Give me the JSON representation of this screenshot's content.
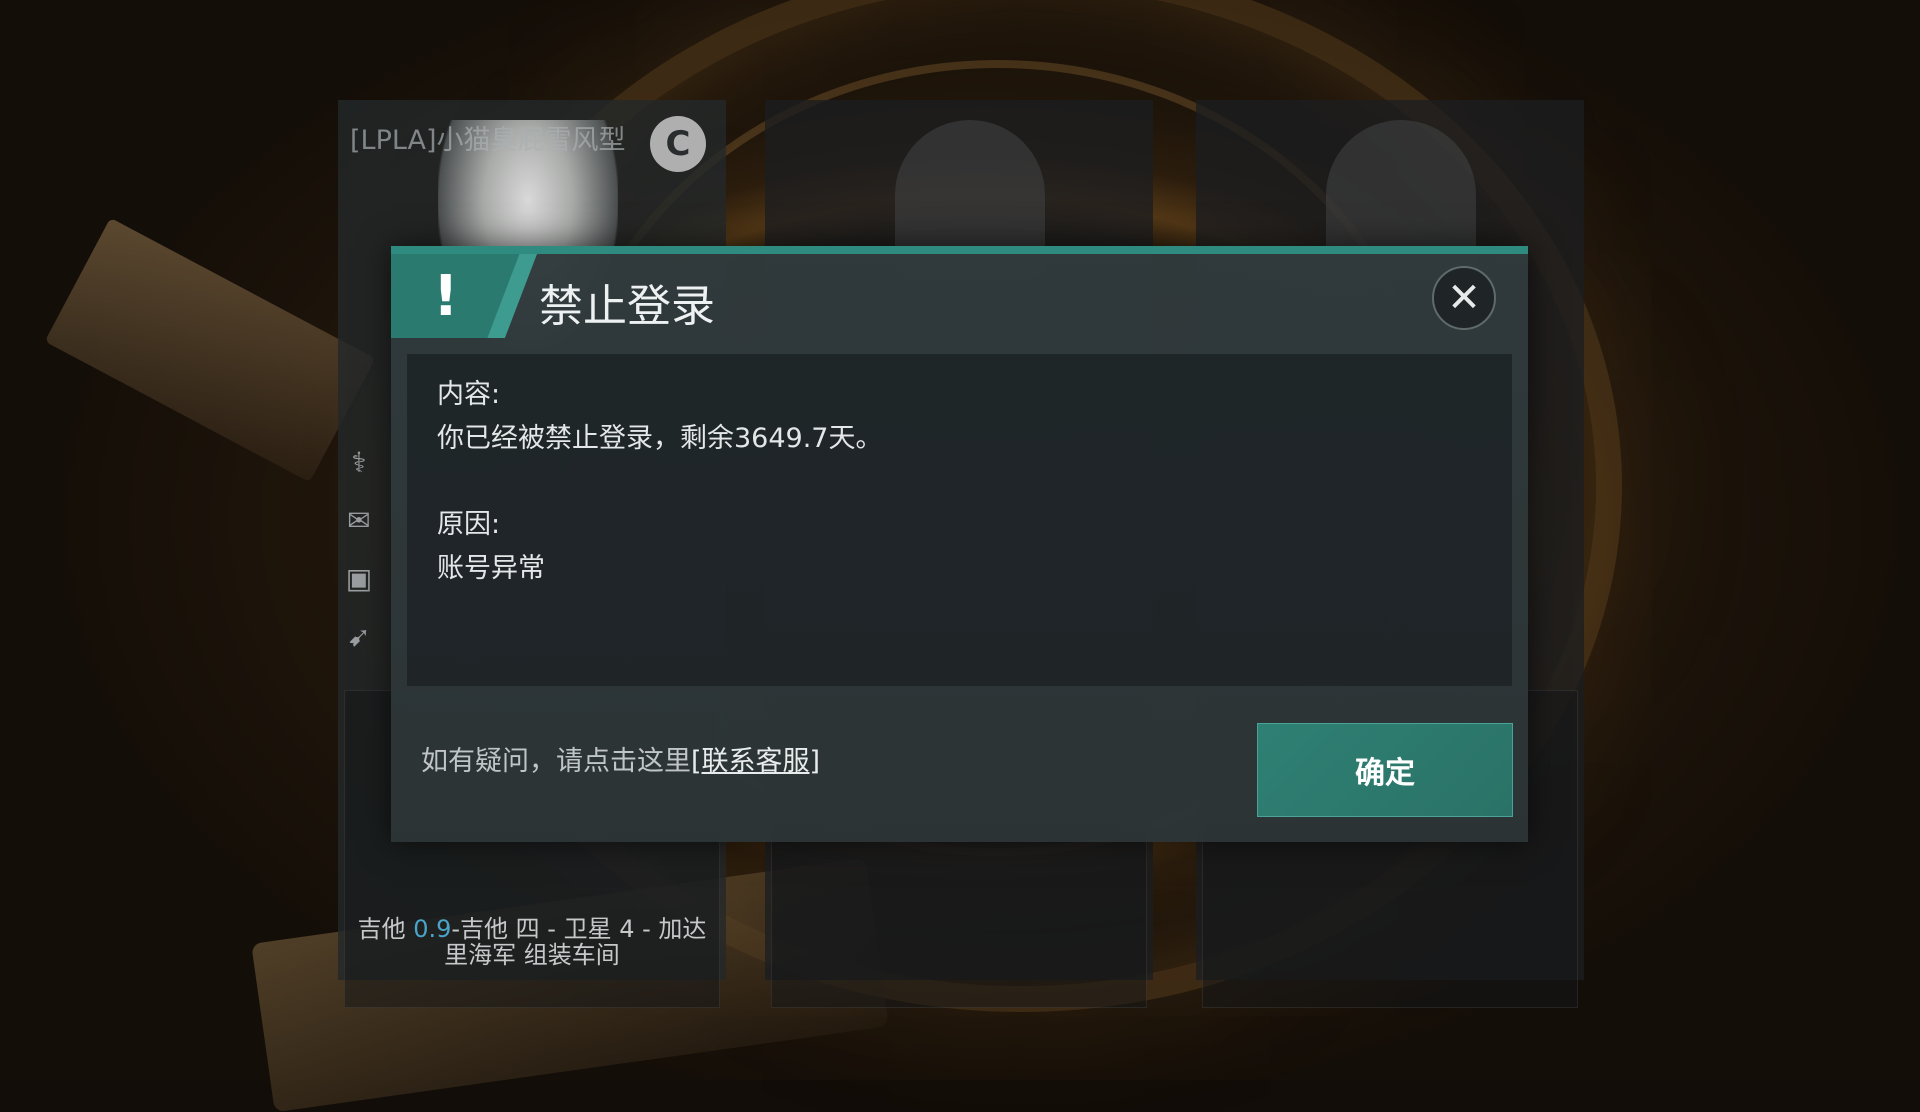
{
  "character": {
    "name": "[LPLA]小猫臭屁雪风型",
    "corp_icon": "C",
    "location_security": "0.9",
    "location_line1": "-吉他 四 - 卫星 4 - 加达",
    "location_system": "吉他 ",
    "location_line2": "里海军 组装车间"
  },
  "side_icons": [
    "dna-icon",
    "mail-icon",
    "wallet-icon",
    "rocket-icon"
  ],
  "dialog": {
    "title": "禁止登录",
    "badge": "!",
    "close_glyph": "✕",
    "content_label": "内容:",
    "content_text": "你已经被禁止登录，剩余3649.7天。",
    "reason_label": "原因:",
    "reason_text": "账号异常",
    "footer_prefix": "如有疑问，请点击这里",
    "footer_link": "[联系客服]",
    "ok_label": "确定"
  },
  "colors": {
    "accent": "#2f8a80",
    "button": "#2f8074"
  }
}
